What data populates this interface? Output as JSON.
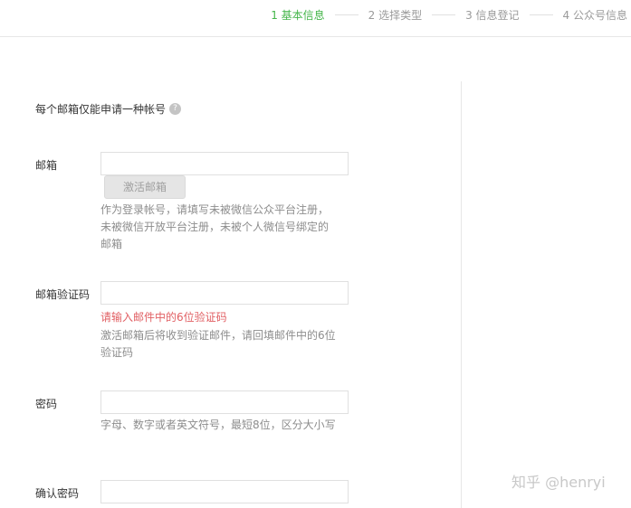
{
  "steps": [
    {
      "label": "1 基本信息",
      "active": true
    },
    {
      "label": "2 选择类型"
    },
    {
      "label": "3 信息登记"
    },
    {
      "label": "4 公众号信息"
    }
  ],
  "notice": "每个邮箱仅能申请一种帐号",
  "help_icon": "?",
  "email": {
    "label": "邮箱",
    "value": "",
    "activate_button": "激活邮箱",
    "tip": "作为登录帐号，请填写未被微信公众平台注册，未被微信开放平台注册，未被个人微信号绑定的邮箱"
  },
  "code": {
    "label": "邮箱验证码",
    "value": "",
    "error": "请输入邮件中的6位验证码",
    "tip": "激活邮箱后将收到验证邮件，请回填邮件中的6位验证码"
  },
  "password": {
    "label": "密码",
    "value": "",
    "tip": "字母、数字或者英文符号，最短8位，区分大小写"
  },
  "confirm": {
    "label": "确认密码",
    "value": ""
  },
  "watermark": "知乎 @henryi"
}
